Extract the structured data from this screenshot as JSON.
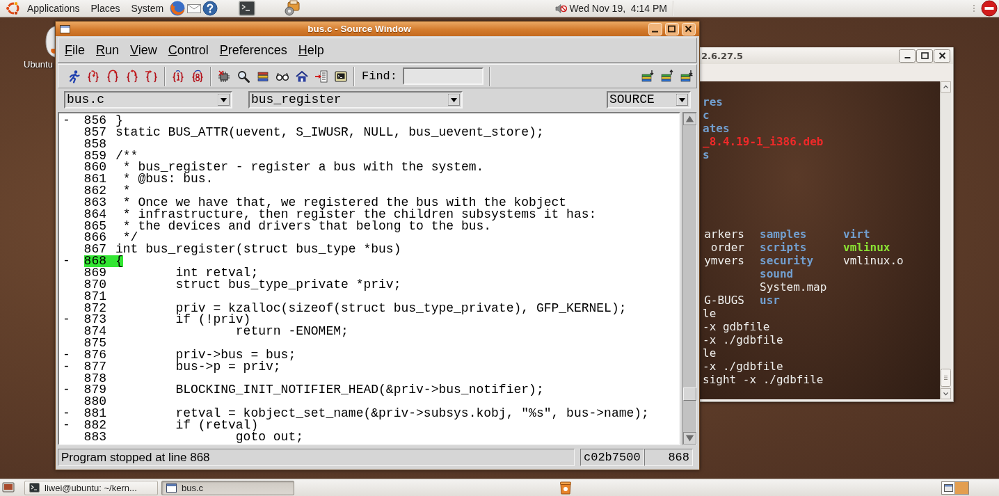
{
  "top_panel": {
    "menus": [
      "Applications",
      "Places",
      "System"
    ],
    "clock": "Wed Nov 19,  4:14 PM"
  },
  "desktop_icon": {
    "label": "Ubuntu"
  },
  "terminal_window": {
    "title": "2.6.27.5",
    "output_top": [
      {
        "text": "res",
        "kind": "directory"
      },
      {
        "text": "c",
        "kind": "directory"
      },
      {
        "text": "ates",
        "kind": "directory"
      },
      {
        "text": "_8.4.19-1_i386.deb",
        "kind": "archive"
      },
      {
        "text": "s",
        "kind": "directory"
      }
    ],
    "listing": [
      {
        "left": {
          "text": "arkers",
          "kind": "file"
        },
        "middle": {
          "text": "samples",
          "kind": "directory"
        },
        "right": {
          "text": "virt",
          "kind": "directory"
        }
      },
      {
        "left": {
          "text": "order",
          "kind": "file"
        },
        "middle": {
          "text": "scripts",
          "kind": "directory"
        },
        "right": {
          "text": "vmlinux",
          "kind": "executable"
        }
      },
      {
        "left": {
          "text": "ymvers",
          "kind": "file"
        },
        "middle": {
          "text": "security",
          "kind": "directory"
        },
        "right": {
          "text": "vmlinux.o",
          "kind": "file"
        }
      },
      {
        "middle": {
          "text": "sound",
          "kind": "directory"
        }
      },
      {
        "middle": {
          "text": "System.map",
          "kind": "file"
        }
      },
      {
        "left": {
          "text": "G-BUGS",
          "kind": "file"
        },
        "middle": {
          "text": "usr",
          "kind": "directory"
        }
      }
    ],
    "command_lines": [
      "le",
      "-x gdbfile",
      "-x ./gdbfile",
      "le",
      "-x ./gdbfile",
      "sight -x ./gdbfile"
    ]
  },
  "source_window": {
    "title": "bus.c - Source Window",
    "menus": [
      "File",
      "Run",
      "View",
      "Control",
      "Preferences",
      "Help"
    ],
    "find_label": "Find:",
    "selectors": [
      "bus.c",
      "bus_register",
      "SOURCE"
    ],
    "code_lines": [
      {
        "marker": "-",
        "number": "856",
        "code": "}",
        "current": false
      },
      {
        "number": "857",
        "code": "static BUS_ATTR(uevent, S_IWUSR, NULL, bus_uevent_store);",
        "current": false
      },
      {
        "number": "858",
        "current": false
      },
      {
        "number": "859",
        "code": "/**",
        "current": false
      },
      {
        "number": "860",
        "code": " * bus_register - register a bus with the system.",
        "current": false
      },
      {
        "number": "861",
        "code": " * @bus: bus.",
        "current": false
      },
      {
        "number": "862",
        "code": " *",
        "current": false
      },
      {
        "number": "863",
        "code": " * Once we have that, we registered the bus with the kobject",
        "current": false
      },
      {
        "number": "864",
        "code": " * infrastructure, then register the children subsystems it has:",
        "current": false
      },
      {
        "number": "865",
        "code": " * the devices and drivers that belong to the bus.",
        "current": false
      },
      {
        "number": "866",
        "code": " */",
        "current": false
      },
      {
        "number": "867",
        "code": "int bus_register(struct bus_type *bus)",
        "current": false
      },
      {
        "marker": "-",
        "number": "868",
        "code": "{",
        "current": true
      },
      {
        "number": "869",
        "code": "        int retval;",
        "current": false
      },
      {
        "number": "870",
        "code": "        struct bus_type_private *priv;",
        "current": false
      },
      {
        "number": "871",
        "current": false
      },
      {
        "number": "872",
        "code": "        priv = kzalloc(sizeof(struct bus_type_private), GFP_KERNEL);",
        "current": false
      },
      {
        "marker": "-",
        "number": "873",
        "code": "        if (!priv)",
        "current": false
      },
      {
        "number": "874",
        "code": "                return -ENOMEM;",
        "current": false
      },
      {
        "number": "875",
        "current": false
      },
      {
        "marker": "-",
        "number": "876",
        "code": "        priv->bus = bus;",
        "current": false
      },
      {
        "marker": "-",
        "number": "877",
        "code": "        bus->p = priv;",
        "current": false
      },
      {
        "number": "878",
        "current": false
      },
      {
        "marker": "-",
        "number": "879",
        "code": "        BLOCKING_INIT_NOTIFIER_HEAD(&priv->bus_notifier);",
        "current": false
      },
      {
        "number": "880",
        "current": false
      },
      {
        "marker": "-",
        "number": "881",
        "code": "        retval = kobject_set_name(&priv->subsys.kobj, \"%s\", bus->name);",
        "current": false
      },
      {
        "marker": "-",
        "number": "882",
        "code": "        if (retval)",
        "current": false
      },
      {
        "number": "883",
        "code": "                goto out;",
        "current": false
      }
    ],
    "status": {
      "message": "Program stopped at line 868",
      "address": "c02b7500",
      "line": "868"
    }
  },
  "taskbar": {
    "tasks": [
      {
        "label": "liwei@ubuntu: ~/kern...",
        "kind": "terminal",
        "selected": false
      },
      {
        "label": "bus.c",
        "kind": "window",
        "selected": true
      }
    ],
    "workspaces": [
      {
        "selected": true
      },
      {
        "selected": false
      }
    ]
  }
}
